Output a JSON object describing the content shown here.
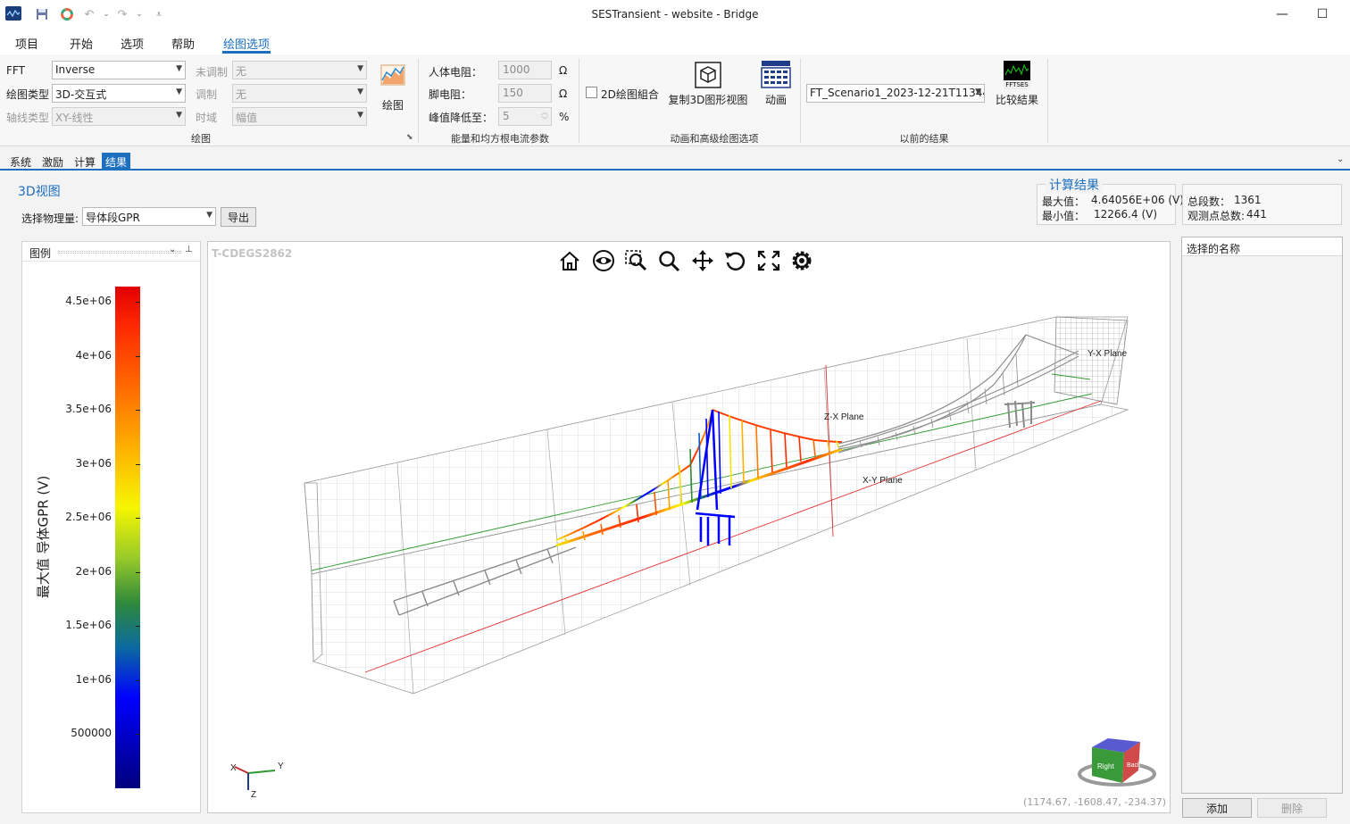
{
  "window": {
    "title": "SESTransient - website - Bridge",
    "minimize_glyph": "—",
    "maximize_glyph": "☐"
  },
  "menu": {
    "items": [
      "项目",
      "开始",
      "选项",
      "帮助",
      "绘图选项"
    ],
    "active_index": 4
  },
  "ribbon": {
    "plot_group": {
      "label": "绘图",
      "fft_label": "FFT",
      "fft_value": "Inverse",
      "plot_type_label": "绘图类型",
      "plot_type_value": "3D-交互式",
      "axis_type_label": "轴线类型",
      "axis_type_value": "XY-线性",
      "unmodulated_label": "未调制",
      "unmodulated_value": "无",
      "modulation_label": "调制",
      "modulation_value": "无",
      "time_domain_label": "时域",
      "time_domain_value": "幅值",
      "plot_button_label": "绘图"
    },
    "energy_group": {
      "label": "能量和均方根电流参数",
      "body_resistance_label": "人体电阻：",
      "body_resistance_value": "1000",
      "body_resistance_unit": "Ω",
      "foot_resistance_label": "脚电阻：",
      "foot_resistance_value": "150",
      "foot_resistance_unit": "Ω",
      "peak_drop_label": "峰值降低至：",
      "peak_drop_value": "5",
      "peak_drop_unit": "%"
    },
    "animation_group": {
      "label": "动画和高级绘图选项",
      "combine_2d_label": "2D绘图組合",
      "copy_3d_label": "复制3D图形视图",
      "animation_label": "动画"
    },
    "previous_group": {
      "label": "以前的结果",
      "scenario_value": "FT_Scenario1_2023-12-21T113447",
      "compare_icon_text": "FFTSES",
      "compare_label": "比较結果"
    }
  },
  "tabs": [
    "系统",
    "激励",
    "计算",
    "结果"
  ],
  "active_tab_index": 3,
  "results": {
    "view_title": "3D视图",
    "select_quantity_label": "选择物理量:",
    "select_quantity_value": "导体段GPR",
    "export_label": "导出",
    "calc_title": "计算结果",
    "max_label": "最大值：",
    "max_value": "4.64056E+06  (V)",
    "min_label": "最小值：",
    "min_value": "12266.4  (V)",
    "total_segments_label": "总段数：",
    "total_segments_value": "1361",
    "total_points_label": "观测点总数:",
    "total_points_value": "441"
  },
  "legend": {
    "title": "图例",
    "axis_title": "最大值 导体GPR  (V)",
    "ticks": [
      {
        "label": "4.5e+06",
        "value": 4500000
      },
      {
        "label": "4e+06",
        "value": 4000000
      },
      {
        "label": "3.5e+06",
        "value": 3500000
      },
      {
        "label": "3e+06",
        "value": 3000000
      },
      {
        "label": "2.5e+06",
        "value": 2500000
      },
      {
        "label": "2e+06",
        "value": 2000000
      },
      {
        "label": "1.5e+06",
        "value": 1500000
      },
      {
        "label": "1e+06",
        "value": 1000000
      },
      {
        "label": "500000",
        "value": 500000
      }
    ],
    "range": [
      0,
      4640560
    ]
  },
  "viewport": {
    "watermark": "T-CDEGS2862",
    "plane_labels": {
      "zx": "Z-X Plane",
      "xy": "X-Y Plane",
      "yx": "Y-X Plane"
    },
    "axis_labels": {
      "x": "X",
      "y": "Y",
      "z": "Z"
    },
    "cube_labels": {
      "right": "Right",
      "back": "Back"
    },
    "coordinates": "(1174.67, -1608.47, -234.37)",
    "toolbar_icons": [
      "home-icon",
      "eye-icon",
      "zoom-window-icon",
      "zoom-icon",
      "pan-icon",
      "rotate-icon",
      "fullscreen-icon",
      "settings-gear-icon"
    ],
    "colors": {
      "accent": "#1d6fbf",
      "grid": "#b0b0b0",
      "x_axis": "#e03030",
      "y_axis": "#2e9a2e",
      "z_axis": "#e03030"
    }
  },
  "names_panel": {
    "header": "选择的名称",
    "add_label": "添加",
    "delete_label": "删除"
  }
}
